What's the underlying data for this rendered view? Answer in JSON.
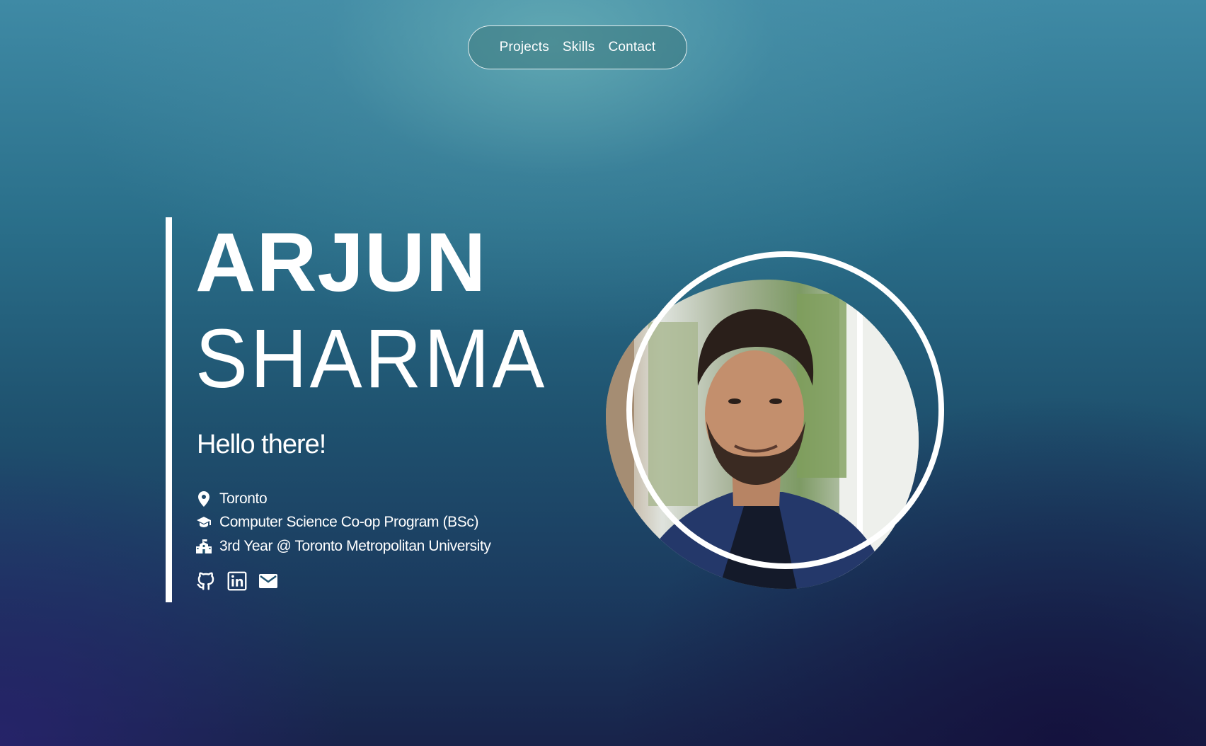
{
  "nav": {
    "items": [
      "Projects",
      "Skills",
      "Contact"
    ]
  },
  "hero": {
    "first_name": "ARJUN",
    "last_name": "SHARMA",
    "greeting": "Hello there!",
    "info": [
      {
        "icon": "location-pin-icon",
        "text": "Toronto"
      },
      {
        "icon": "graduation-cap-icon",
        "text": "Computer Science Co-op Program (BSc)"
      },
      {
        "icon": "school-building-icon",
        "text": "3rd Year @ Toronto Metropolitan University"
      }
    ],
    "socials": [
      "github-icon",
      "linkedin-icon",
      "email-icon"
    ]
  },
  "portrait": {
    "subject": "profile-photo"
  },
  "colors": {
    "accent": "#ffffff",
    "background_top": "#3f8aa5",
    "background_bottom": "#18234a"
  }
}
